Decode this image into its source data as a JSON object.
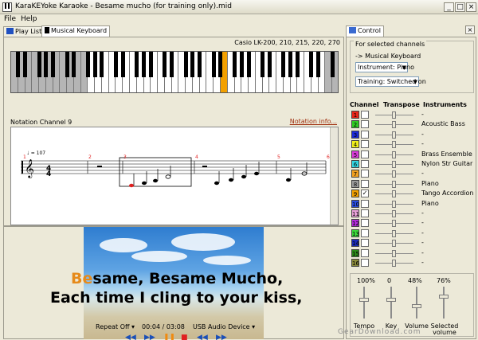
{
  "window": {
    "title": "KaraKEYoke Karaoke - Besame mucho (for training only).mid",
    "min_label": "_",
    "max_label": "□",
    "close_label": "×"
  },
  "menu": {
    "file": "File",
    "help": "Help"
  },
  "tabs": {
    "playlist": "Play List",
    "keyboard": "Musical Keyboard",
    "control": "Control"
  },
  "keyboard": {
    "model": "Casio LK-200, 210, 215, 220, 270",
    "highlight_color": "#f2a000"
  },
  "notation": {
    "label": "Notation Channel 9",
    "link": "Notation info...",
    "tempo": "♩ = 107",
    "measures": [
      "1",
      "2",
      "3",
      "4",
      "5",
      "6"
    ]
  },
  "lyrics": {
    "line1_sung": "Be",
    "line1_rest": "same, Besame Mucho,",
    "line2": "Each time I cling to your kiss,"
  },
  "playback": {
    "repeat": "Repeat Off",
    "time": "00:04 / 03:08",
    "device": "USB Audio Device"
  },
  "control": {
    "group_title": "For selected channels",
    "sub": "-> Musical Keyboard",
    "instrument": "Instrument: Piano",
    "training": "Training: Switched on",
    "headers": {
      "channel": "Channel",
      "transpose": "Transpose",
      "instruments": "Instruments"
    },
    "channels": [
      {
        "num": "1",
        "color": "#e8251a",
        "checked": "",
        "inst": "-"
      },
      {
        "num": "2",
        "color": "#2ecc22",
        "checked": "",
        "inst": "Acoustic Bass"
      },
      {
        "num": "3",
        "color": "#1c2bd9",
        "checked": "",
        "inst": "-"
      },
      {
        "num": "4",
        "color": "#f0f01a",
        "checked": "",
        "inst": "-"
      },
      {
        "num": "5",
        "color": "#d93bd9",
        "checked": "",
        "inst": "Brass Ensemble"
      },
      {
        "num": "6",
        "color": "#33d6e3",
        "checked": "",
        "inst": "Nylon Str Guitar"
      },
      {
        "num": "7",
        "color": "#f0a020",
        "checked": "",
        "inst": "-"
      },
      {
        "num": "8",
        "color": "#9b9b9b",
        "checked": "",
        "inst": "Piano"
      },
      {
        "num": "9",
        "color": "#f2a000",
        "checked": "✓",
        "inst": "Tango Accordion"
      },
      {
        "num": "10",
        "color": "#2a4ee0",
        "checked": "",
        "inst": "Piano"
      },
      {
        "num": "11",
        "color": "#e8a0d8",
        "checked": "",
        "inst": "-"
      },
      {
        "num": "12",
        "color": "#b02ad9",
        "checked": "",
        "inst": "-"
      },
      {
        "num": "13",
        "color": "#3bd93b",
        "checked": "",
        "inst": "-"
      },
      {
        "num": "14",
        "color": "#1a2ab8",
        "checked": "",
        "inst": "-"
      },
      {
        "num": "15",
        "color": "#2a8a1a",
        "checked": "",
        "inst": "-"
      },
      {
        "num": "16",
        "color": "#8a8a3a",
        "checked": "",
        "inst": "-"
      }
    ],
    "mixer": {
      "tempo_val": "100%",
      "key_val": "0",
      "volume_val": "48%",
      "selected_val": "76%",
      "tempo_label": "Tempo",
      "key_label": "Key",
      "volume_label": "Volume",
      "selected_label": "Selected volume"
    }
  },
  "watermark": "GearDownload.com"
}
